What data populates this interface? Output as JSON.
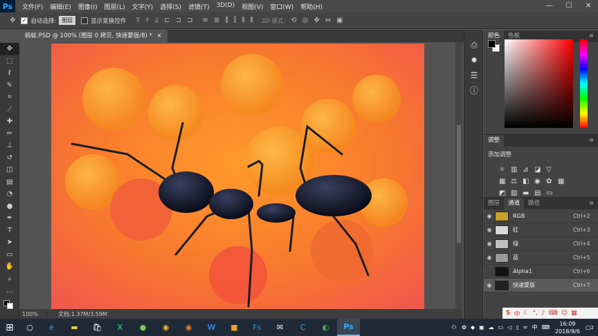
{
  "app": {
    "logo": "Ps"
  },
  "menu": [
    "文件(F)",
    "编辑(E)",
    "图像(I)",
    "图层(L)",
    "文字(Y)",
    "选择(S)",
    "滤镜(T)",
    "3D(D)",
    "视图(V)",
    "窗口(W)",
    "帮助(H)"
  ],
  "window_controls": {
    "min": "—",
    "max": "☐",
    "close": "✕"
  },
  "options": {
    "auto_select": "自动选择:",
    "auto_select_value": "图层",
    "show_transform": "显示变换控件",
    "mode_3d": "3D 模式:"
  },
  "document_tab": {
    "label": "蚂蚁.PSD @ 100% (图层 0 拷贝, 快速蒙版/8) *",
    "close": "×"
  },
  "tools": [
    "move-icon",
    "marquee-icon",
    "lasso-icon",
    "quick-select-icon",
    "crop-icon",
    "eyedropper-icon",
    "healing-icon",
    "brush-icon",
    "stamp-icon",
    "history-brush-icon",
    "eraser-icon",
    "gradient-icon",
    "blur-icon",
    "dodge-icon",
    "pen-icon",
    "type-icon",
    "path-select-icon",
    "shape-icon",
    "hand-icon",
    "zoom-icon",
    "more-icon"
  ],
  "status": {
    "zoom": "100%",
    "doc": "文档:1.37M/3.59M"
  },
  "panels": {
    "color_tabs": [
      "颜色",
      "色板"
    ],
    "adjust_title": "调整",
    "adjust_add": "添加调整",
    "layer_tabs": [
      "图层",
      "通道",
      "路径"
    ],
    "channels": [
      {
        "name": "RGB",
        "shortcut": "Ctrl+2",
        "visible": true,
        "thumb": "#c9a22a"
      },
      {
        "name": "红",
        "shortcut": "Ctrl+3",
        "visible": true,
        "thumb": "#d8d8d8"
      },
      {
        "name": "绿",
        "shortcut": "Ctrl+4",
        "visible": true,
        "thumb": "#bdbdbd"
      },
      {
        "name": "蓝",
        "shortcut": "Ctrl+5",
        "visible": true,
        "thumb": "#999999"
      },
      {
        "name": "Alpha1",
        "shortcut": "Ctrl+6",
        "visible": false,
        "thumb": "#111111"
      },
      {
        "name": "快速蒙版",
        "shortcut": "Ctrl+7",
        "visible": true,
        "thumb": "#222222"
      }
    ]
  },
  "taskbar": {
    "clock_time": "16:09",
    "clock_date": "2018/9/6",
    "ime_lang": "中",
    "notif": "2"
  }
}
